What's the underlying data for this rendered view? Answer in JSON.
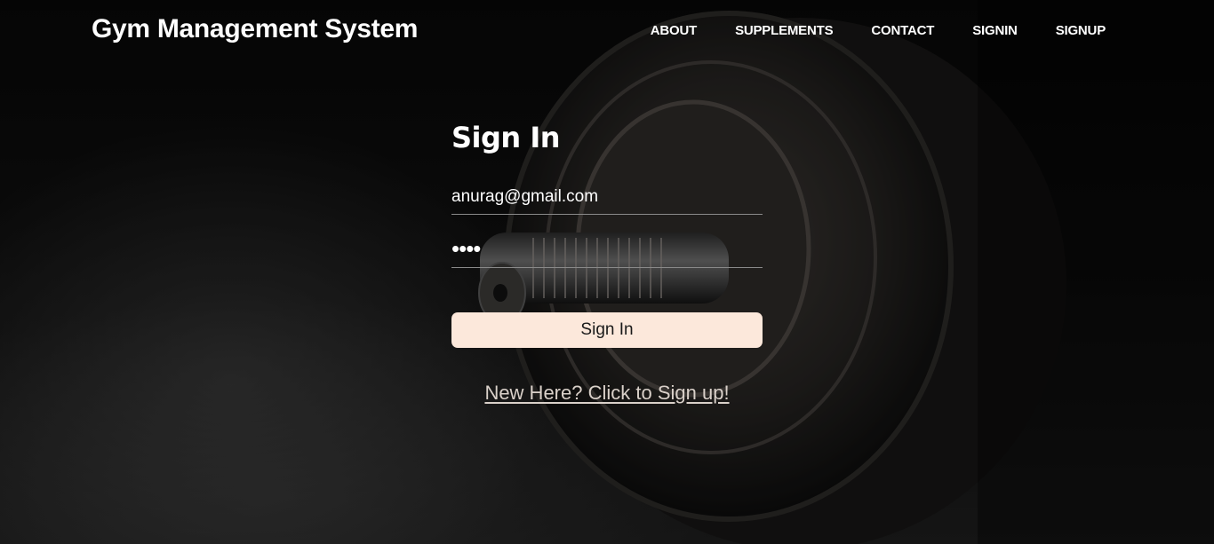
{
  "navbar": {
    "brand": "Gym Management System",
    "links": [
      "ABOUT",
      "SUPPLEMENTS",
      "CONTACT",
      "SIGNIN",
      "SIGNUP"
    ]
  },
  "signin": {
    "title": "Sign In",
    "email_value": "anurag@gmail.com",
    "password_value": "1234",
    "button_label": "Sign In",
    "signup_link": "New Here? Click to Sign up!"
  },
  "colors": {
    "button_bg": "#fce8db",
    "text": "#ffffff",
    "link": "#d9d0c9"
  }
}
